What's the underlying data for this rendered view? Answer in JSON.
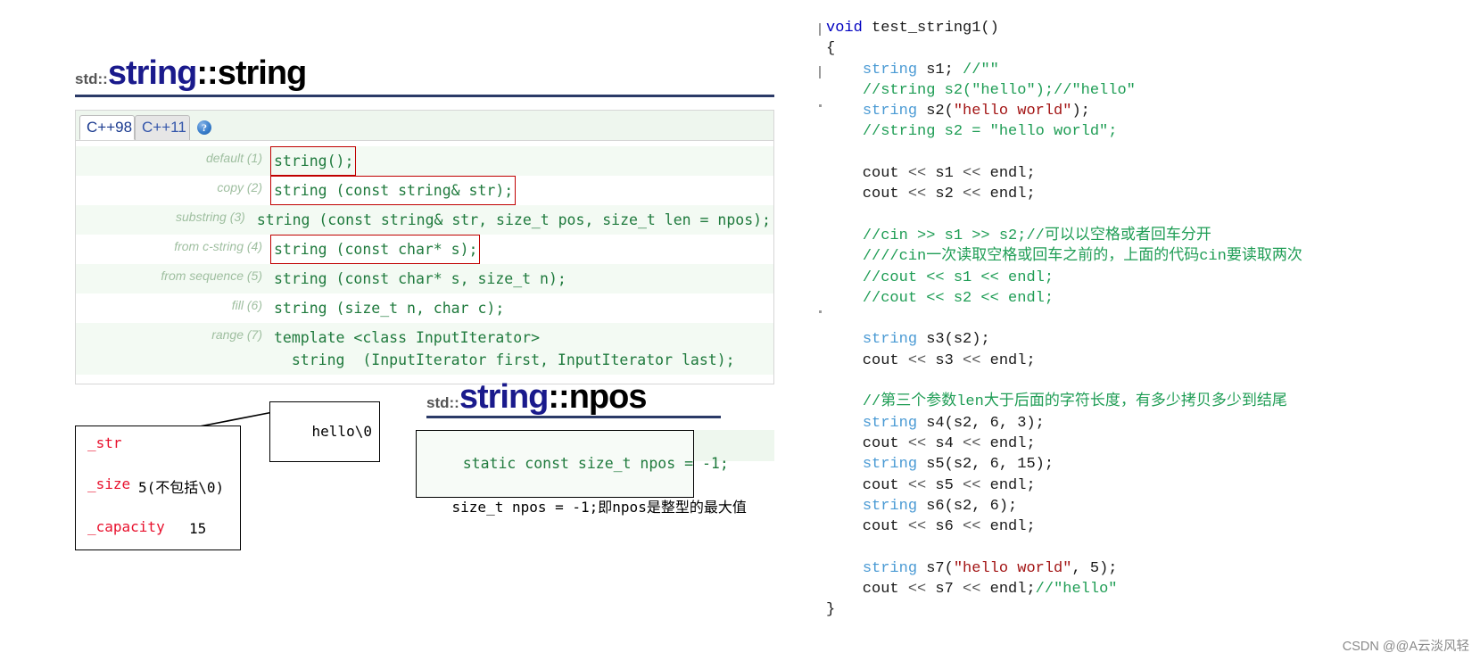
{
  "reference": {
    "ctor": {
      "namespace": "std::",
      "class_name": "string",
      "separator": "::",
      "member": "string",
      "tabs": [
        {
          "label": "C++98",
          "active": true
        },
        {
          "label": "C++11",
          "active": false
        }
      ],
      "help_icon": "help-icon",
      "help_glyph": "?",
      "rows": [
        {
          "label": "default",
          "num": "(1)",
          "signature": "string();",
          "boxed": true
        },
        {
          "label": "copy",
          "num": "(2)",
          "signature": "string (const string& str);",
          "boxed": true
        },
        {
          "label": "substring",
          "num": "(3)",
          "signature": "string (const string& str, size_t pos, size_t len = npos);",
          "boxed": false
        },
        {
          "label": "from c-string",
          "num": "(4)",
          "signature": "string (const char* s);",
          "boxed": true
        },
        {
          "label": "from sequence",
          "num": "(5)",
          "signature": "string (const char* s, size_t n);",
          "boxed": false
        },
        {
          "label": "fill",
          "num": "(6)",
          "signature": "string (size_t n, char c);",
          "boxed": false
        },
        {
          "label": "range",
          "num": "(7)",
          "signature": "template <class InputIterator>\n  string  (InputIterator first, InputIterator last);",
          "boxed": false
        }
      ]
    },
    "npos": {
      "namespace": "std::",
      "class_name": "string",
      "separator": "::",
      "member": "npos",
      "code": "static const size_t npos = -1;",
      "note": "size_t npos = -1;即npos是整型的最大值"
    }
  },
  "memory_diagram": {
    "fields": [
      {
        "name": "_str",
        "value": ""
      },
      {
        "name": "_size",
        "value": "5(不包括\\0)"
      },
      {
        "name": "_capacity",
        "value": "15"
      }
    ],
    "heap_buffer": "hello\\0"
  },
  "code": {
    "language": "cpp",
    "lines": [
      [
        {
          "t": "void",
          "c": "kw"
        },
        {
          "t": " test_string1()",
          "c": "pl"
        }
      ],
      [
        {
          "t": "{",
          "c": "pl"
        }
      ],
      [
        {
          "t": "    ",
          "c": "pl"
        },
        {
          "t": "string",
          "c": "typ"
        },
        {
          "t": " s1; ",
          "c": "pl"
        },
        {
          "t": "//\"\"",
          "c": "cmt"
        }
      ],
      [
        {
          "t": "    ",
          "c": "pl"
        },
        {
          "t": "//string s2(\"hello\");//\"hello\"",
          "c": "cmt"
        }
      ],
      [
        {
          "t": "    ",
          "c": "pl"
        },
        {
          "t": "string",
          "c": "typ"
        },
        {
          "t": " s2(",
          "c": "pl"
        },
        {
          "t": "\"hello world\"",
          "c": "str"
        },
        {
          "t": ");",
          "c": "pl"
        }
      ],
      [
        {
          "t": "    ",
          "c": "pl"
        },
        {
          "t": "//string s2 = \"hello world\";",
          "c": "cmt"
        }
      ],
      [
        {
          "t": "",
          "c": "pl"
        }
      ],
      [
        {
          "t": "    cout ",
          "c": "pl"
        },
        {
          "t": "<<",
          "c": "op"
        },
        {
          "t": " s1 ",
          "c": "pl"
        },
        {
          "t": "<<",
          "c": "op"
        },
        {
          "t": " endl;",
          "c": "pl"
        }
      ],
      [
        {
          "t": "    cout ",
          "c": "pl"
        },
        {
          "t": "<<",
          "c": "op"
        },
        {
          "t": " s2 ",
          "c": "pl"
        },
        {
          "t": "<<",
          "c": "op"
        },
        {
          "t": " endl;",
          "c": "pl"
        }
      ],
      [
        {
          "t": "",
          "c": "pl"
        }
      ],
      [
        {
          "t": "    ",
          "c": "pl"
        },
        {
          "t": "//cin >> s1 >> s2;//可以以空格或者回车分开",
          "c": "cmt"
        }
      ],
      [
        {
          "t": "    ",
          "c": "pl"
        },
        {
          "t": "////cin一次读取空格或回车之前的，上面的代码cin要读取两次",
          "c": "cmt"
        }
      ],
      [
        {
          "t": "    ",
          "c": "pl"
        },
        {
          "t": "//cout << s1 << endl;",
          "c": "cmt"
        }
      ],
      [
        {
          "t": "    ",
          "c": "pl"
        },
        {
          "t": "//cout << s2 << endl;",
          "c": "cmt"
        }
      ],
      [
        {
          "t": "",
          "c": "pl"
        }
      ],
      [
        {
          "t": "    ",
          "c": "pl"
        },
        {
          "t": "string",
          "c": "typ"
        },
        {
          "t": " s3(s2);",
          "c": "pl"
        }
      ],
      [
        {
          "t": "    cout ",
          "c": "pl"
        },
        {
          "t": "<<",
          "c": "op"
        },
        {
          "t": " s3 ",
          "c": "pl"
        },
        {
          "t": "<<",
          "c": "op"
        },
        {
          "t": " endl;",
          "c": "pl"
        }
      ],
      [
        {
          "t": "",
          "c": "pl"
        }
      ],
      [
        {
          "t": "    ",
          "c": "pl"
        },
        {
          "t": "//第三个参数len大于后面的字符长度，有多少拷贝多少到结尾",
          "c": "cmt"
        }
      ],
      [
        {
          "t": "    ",
          "c": "pl"
        },
        {
          "t": "string",
          "c": "typ"
        },
        {
          "t": " s4(s2, 6, 3);",
          "c": "pl"
        }
      ],
      [
        {
          "t": "    cout ",
          "c": "pl"
        },
        {
          "t": "<<",
          "c": "op"
        },
        {
          "t": " s4 ",
          "c": "pl"
        },
        {
          "t": "<<",
          "c": "op"
        },
        {
          "t": " endl;",
          "c": "pl"
        }
      ],
      [
        {
          "t": "    ",
          "c": "pl"
        },
        {
          "t": "string",
          "c": "typ"
        },
        {
          "t": " s5(s2, 6, 15);",
          "c": "pl"
        }
      ],
      [
        {
          "t": "    cout ",
          "c": "pl"
        },
        {
          "t": "<<",
          "c": "op"
        },
        {
          "t": " s5 ",
          "c": "pl"
        },
        {
          "t": "<<",
          "c": "op"
        },
        {
          "t": " endl;",
          "c": "pl"
        }
      ],
      [
        {
          "t": "    ",
          "c": "pl"
        },
        {
          "t": "string",
          "c": "typ"
        },
        {
          "t": " s6(s2, 6);",
          "c": "pl"
        }
      ],
      [
        {
          "t": "    cout ",
          "c": "pl"
        },
        {
          "t": "<<",
          "c": "op"
        },
        {
          "t": " s6 ",
          "c": "pl"
        },
        {
          "t": "<<",
          "c": "op"
        },
        {
          "t": " endl;",
          "c": "pl"
        }
      ],
      [
        {
          "t": "",
          "c": "pl"
        }
      ],
      [
        {
          "t": "    ",
          "c": "pl"
        },
        {
          "t": "string",
          "c": "typ"
        },
        {
          "t": " s7(",
          "c": "pl"
        },
        {
          "t": "\"hello world\"",
          "c": "str"
        },
        {
          "t": ", 5);",
          "c": "pl"
        }
      ],
      [
        {
          "t": "    cout ",
          "c": "pl"
        },
        {
          "t": "<<",
          "c": "op"
        },
        {
          "t": " s7 ",
          "c": "pl"
        },
        {
          "t": "<<",
          "c": "op"
        },
        {
          "t": " endl;",
          "c": "pl"
        },
        {
          "t": "//\"hello\"",
          "c": "cmt"
        }
      ],
      [
        {
          "t": "}",
          "c": "pl"
        }
      ]
    ]
  },
  "watermark": "CSDN @@A云淡风轻",
  "colors": {
    "title_blue": "#1a1a8c",
    "rule_blue": "#2b3a67",
    "signature_green": "#1f7a3d",
    "highlight_red": "#c00000",
    "field_red": "#e8112d",
    "comment_green": "#1f9d55",
    "keyword_blue": "#0000c0",
    "type_blue": "#4a9ad4",
    "string_red": "#a31515"
  }
}
